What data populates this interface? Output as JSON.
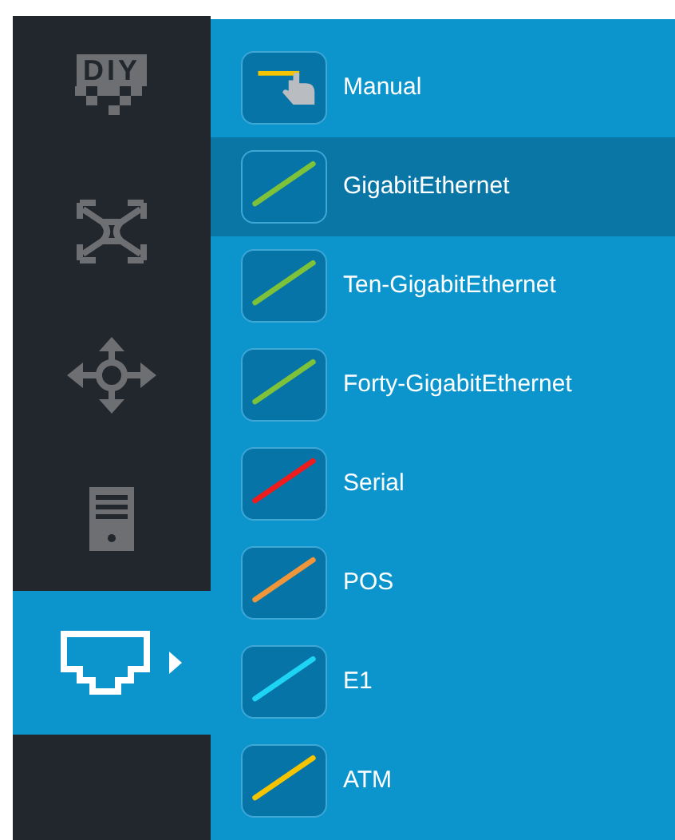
{
  "sidebar": {
    "items": [
      {
        "kind": "diy",
        "text": "DIY",
        "selected": false
      },
      {
        "kind": "cross",
        "selected": false
      },
      {
        "kind": "move",
        "selected": false
      },
      {
        "kind": "server",
        "selected": false
      },
      {
        "kind": "port",
        "selected": true
      }
    ]
  },
  "menu": {
    "items": [
      {
        "kind": "manual",
        "label": "Manual",
        "color": "#f5c400",
        "selected": false
      },
      {
        "kind": "cable",
        "label": "GigabitEthernet",
        "color": "#7ec23a",
        "selected": true
      },
      {
        "kind": "cable",
        "label": "Ten-GigabitEthernet",
        "color": "#7ec23a",
        "selected": false
      },
      {
        "kind": "cable",
        "label": "Forty-GigabitEthernet",
        "color": "#7ec23a",
        "selected": false
      },
      {
        "kind": "cable",
        "label": "Serial",
        "color": "#ee1c1c",
        "selected": false
      },
      {
        "kind": "cable",
        "label": "POS",
        "color": "#f0963a",
        "selected": false
      },
      {
        "kind": "cable",
        "label": "E1",
        "color": "#1ed4f5",
        "selected": false
      },
      {
        "kind": "cable",
        "label": "ATM",
        "color": "#f5c400",
        "selected": false
      }
    ]
  }
}
